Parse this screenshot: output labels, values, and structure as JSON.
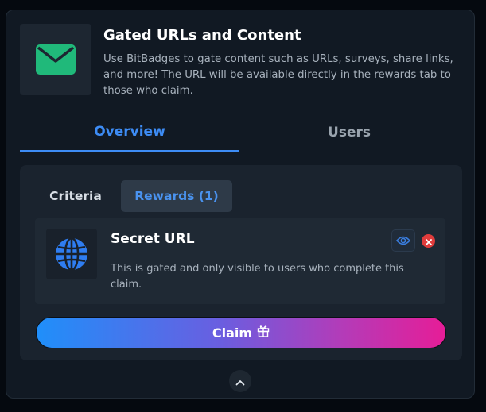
{
  "header": {
    "icon": "envelope-icon",
    "title": "Gated URLs and Content",
    "description": "Use BitBadges to gate content such as URLs, surveys, share links, and more! The URL will be available directly in the rewards tab to those who claim."
  },
  "tabs": [
    {
      "label": "Overview",
      "active": true
    },
    {
      "label": "Users",
      "active": false
    }
  ],
  "subtabs": [
    {
      "label": "Criteria",
      "active": false
    },
    {
      "label": "Rewards (1)",
      "active": true
    }
  ],
  "reward": {
    "icon": "globe-icon",
    "title": "Secret URL",
    "description": "This is gated and only visible to users who complete this claim.",
    "actions": [
      "eye-icon",
      "close-icon"
    ]
  },
  "claim": {
    "label": "Claim",
    "icon": "gift-icon"
  },
  "footer": {
    "icon": "chevron-up-icon"
  },
  "colors": {
    "accent": "#3d8cf5",
    "envelope": "#20b97a",
    "danger": "#e03c3c",
    "gradient_start": "#1f8ffa",
    "gradient_end": "#e61d97"
  }
}
